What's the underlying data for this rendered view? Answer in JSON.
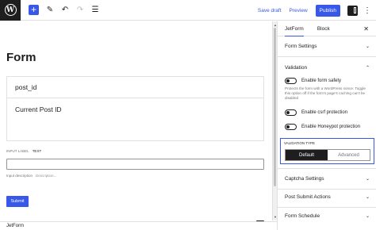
{
  "toolbar": {
    "wp_logo": "W",
    "add_icon": "+",
    "save_draft": "Save draft",
    "preview": "Preview",
    "publish": "Publish"
  },
  "canvas": {
    "title": "Form",
    "fields": [
      "post_id",
      "Current Post ID"
    ],
    "input_label_caption": "INPUT LABEL",
    "input_label_value": "TEXT",
    "input_desc_caption": "Input description",
    "input_desc_placeholder": "Description...",
    "submit": "Submit"
  },
  "statusbar": {
    "text": "JetForm"
  },
  "sidebar": {
    "tabs": [
      "JetForm",
      "Block"
    ],
    "panels": {
      "form_settings": "Form Settings",
      "validation": "Validation",
      "captcha": "Captcha Settings",
      "post_submit": "Post Submit Actions",
      "schedule": "Form Schedule"
    },
    "toggles": {
      "safety": "Enable form safety",
      "safety_help": "Protects the form with a WordPress nonce. Toggle this option off if the form's page's caching can't be disabled",
      "csrf": "Enable csrf protection",
      "honeypot": "Enable Honeypot protection"
    },
    "validation_type": {
      "label": "VALIDATION TYPE",
      "options": [
        "Default",
        "Advanced"
      ],
      "selected": "Default"
    }
  },
  "icons": {
    "undo": "undo-icon",
    "redo": "redo-icon",
    "edit": "pencil-icon",
    "list": "list-view-icon",
    "close": "close-icon",
    "kebab": "more-vertical-icon"
  },
  "colors": {
    "accent": "#3858e9",
    "dark": "#1e1e1e"
  }
}
